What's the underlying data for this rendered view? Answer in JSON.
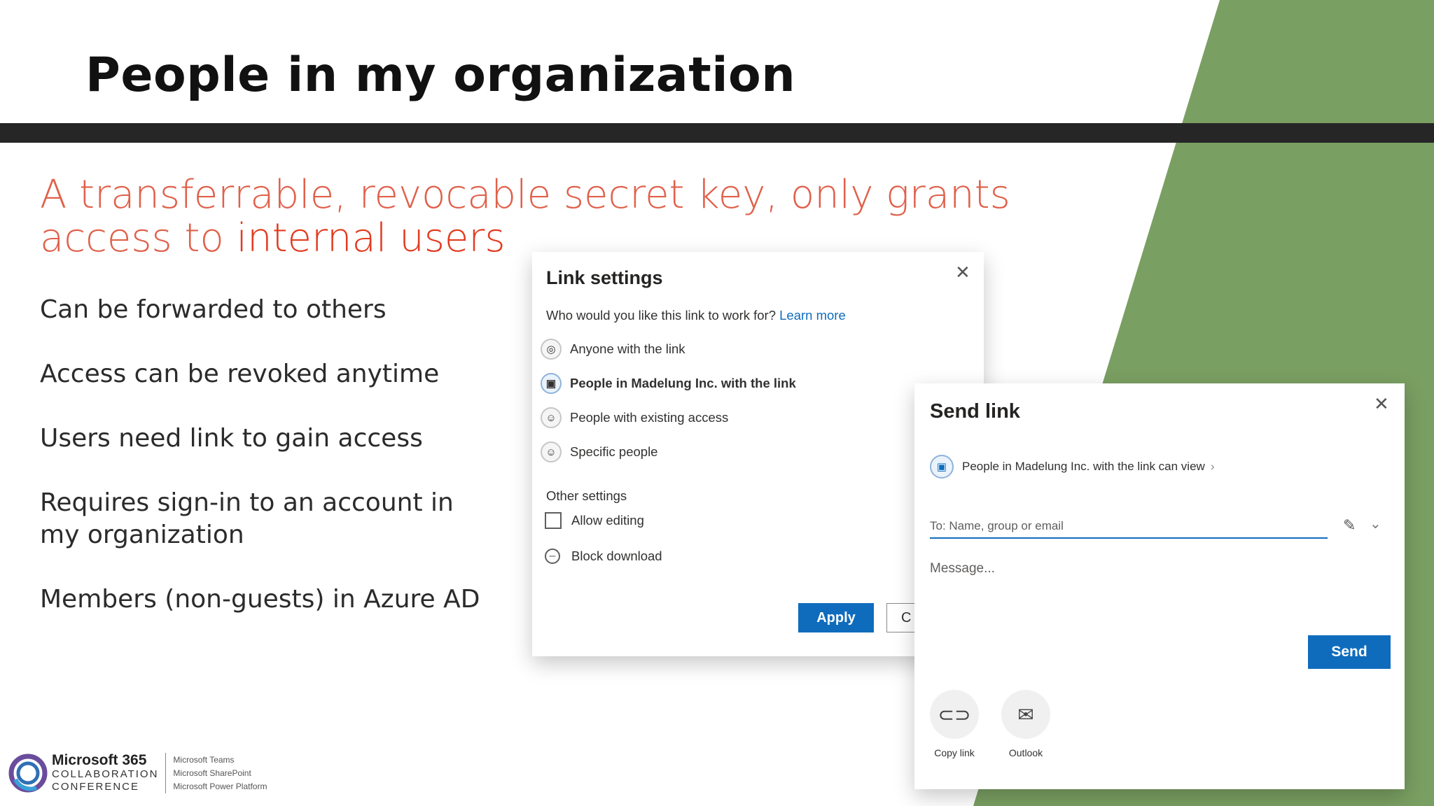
{
  "slide": {
    "title": "People in my organization",
    "subtitle_part1": "A transferrable, revocable secret key, only grants access to ",
    "subtitle_emph": "internal users",
    "bullets": [
      "Can be forwarded to others",
      "Access can be revoked anytime",
      "Users need link to gain access",
      "Requires sign-in to an account in my organization",
      "Members (non-guests) in Azure AD"
    ]
  },
  "link_settings": {
    "title": "Link settings",
    "question": "Who would you like this link to work for?",
    "learn_more": "Learn more",
    "options": [
      {
        "label": "Anyone with the link",
        "icon": "globe-icon",
        "selected": false
      },
      {
        "label": "People in Madelung Inc. with the link",
        "icon": "building-icon",
        "selected": true
      },
      {
        "label": "People with existing access",
        "icon": "people-icon",
        "selected": false
      },
      {
        "label": "Specific people",
        "icon": "people-icon",
        "selected": false
      }
    ],
    "other_settings": "Other settings",
    "allow_editing": "Allow editing",
    "block_download": "Block download",
    "apply": "Apply",
    "cancel": "C"
  },
  "send_link": {
    "title": "Send link",
    "scope": "People in Madelung Inc. with the link can view",
    "to_placeholder": "To: Name, group or email",
    "message_placeholder": "Message...",
    "send": "Send",
    "copy_link": "Copy link",
    "outlook": "Outlook"
  },
  "logo": {
    "line1": "Microsoft 365",
    "line2": "COLLABORATION",
    "line3": "CONFERENCE",
    "products": [
      "Microsoft Teams",
      "Microsoft SharePoint",
      "Microsoft Power Platform"
    ]
  },
  "colors": {
    "accent_green": "#7a9f62",
    "title_bar": "#262626",
    "subtitle": "#e0604a",
    "primary_button": "#0f6cbd"
  }
}
